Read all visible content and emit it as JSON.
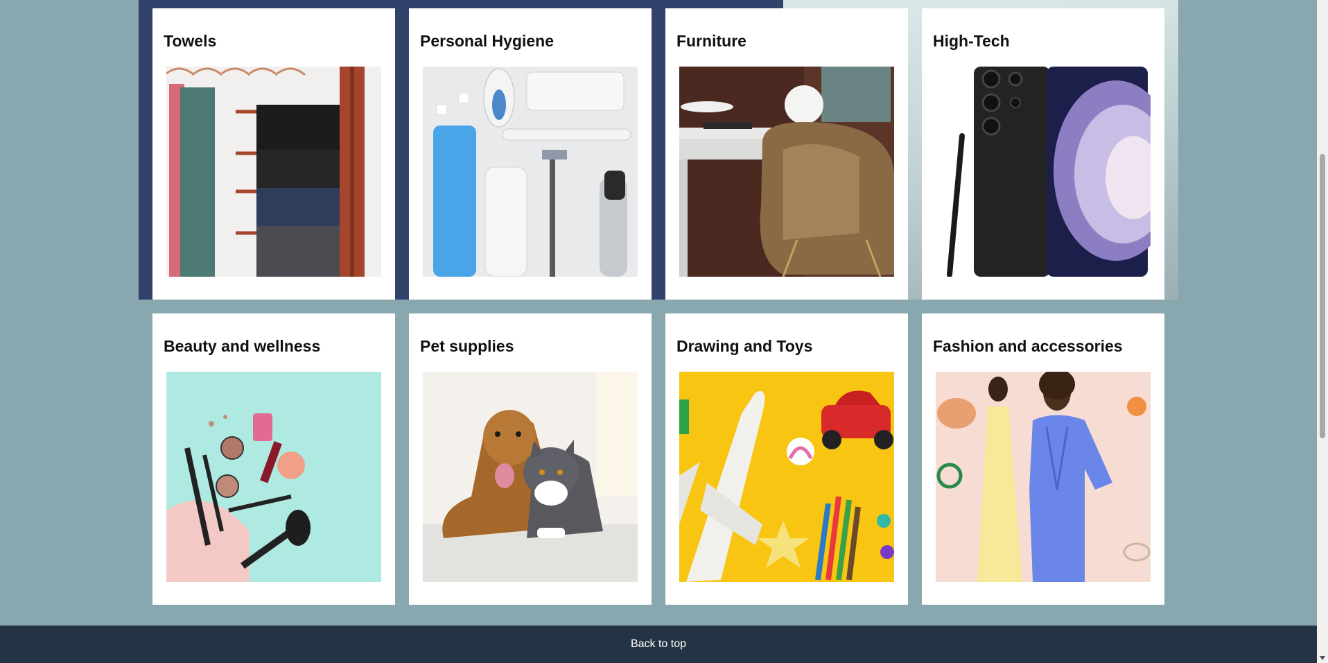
{
  "categories": [
    {
      "title": "Towels",
      "image_alt": "towels-on-hanger"
    },
    {
      "title": "Personal Hygiene",
      "image_alt": "hygiene-products"
    },
    {
      "title": "Furniture",
      "image_alt": "desk-and-chair"
    },
    {
      "title": "High-Tech",
      "image_alt": "smartphone-with-stylus"
    },
    {
      "title": "Beauty and wellness",
      "image_alt": "makeup-products"
    },
    {
      "title": "Pet supplies",
      "image_alt": "dog-and-cat"
    },
    {
      "title": "Drawing and Toys",
      "image_alt": "toys-and-pencils"
    },
    {
      "title": "Fashion and accessories",
      "image_alt": "fashion-models"
    }
  ],
  "footer": {
    "back_to_top": "Back to top"
  }
}
